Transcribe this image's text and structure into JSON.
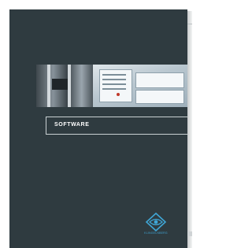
{
  "cover": {
    "title": "SOFTWARE",
    "background_color": "#2f3b40",
    "accent_color": "#3fa6d6"
  },
  "photo": {
    "subject": "testing machine and software screen"
  },
  "logo": {
    "icon": "eye-diamond-logo",
    "text": "KLINGELNBERG"
  }
}
